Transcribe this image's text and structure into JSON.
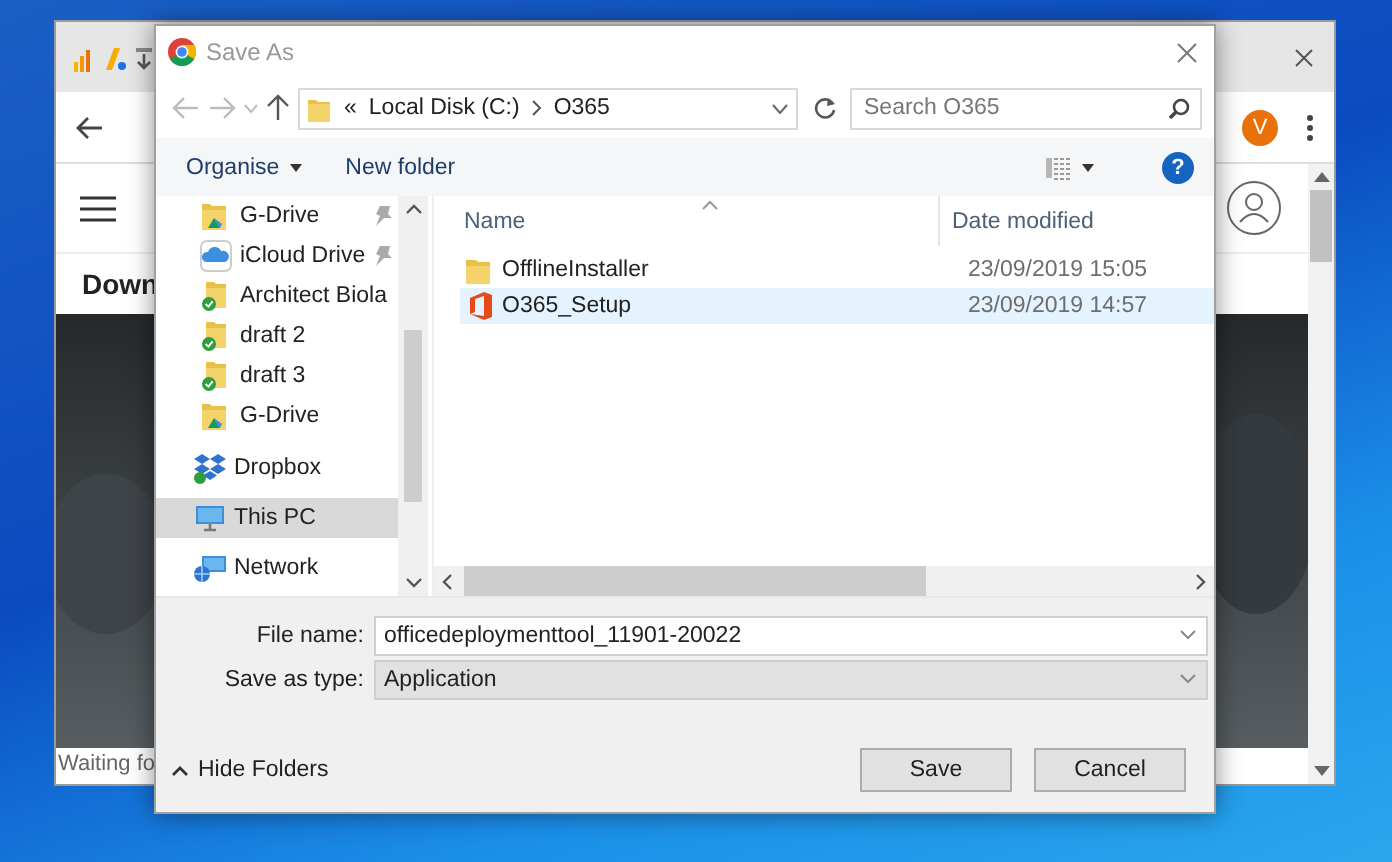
{
  "browser": {
    "page_heading": "Down",
    "status_text": "Waiting fo",
    "account_initial": "V"
  },
  "dialog": {
    "title": "Save As",
    "address": {
      "overflow_mark": "«",
      "path": [
        "Local Disk (C:)",
        "O365"
      ]
    },
    "search": {
      "placeholder": "Search O365"
    },
    "toolbar": {
      "organise": "Organise",
      "new_folder": "New folder",
      "help": "?"
    },
    "quick_access": [
      {
        "label": "G-Drive",
        "kind": "gdrive",
        "pinned": true,
        "selected": false
      },
      {
        "label": "iCloud Drive",
        "kind": "icloud",
        "pinned": true,
        "selected": false
      },
      {
        "label": "Architect Biola",
        "kind": "synced_folder",
        "pinned": false,
        "selected": false
      },
      {
        "label": "draft 2",
        "kind": "synced_folder",
        "pinned": false,
        "selected": false
      },
      {
        "label": "draft 3",
        "kind": "synced_folder",
        "pinned": false,
        "selected": false
      },
      {
        "label": "G-Drive",
        "kind": "gdrive",
        "pinned": false,
        "selected": false
      }
    ],
    "locations": [
      {
        "label": "Dropbox",
        "kind": "dropbox",
        "selected": false
      },
      {
        "label": "This PC",
        "kind": "pc",
        "selected": true
      },
      {
        "label": "Network",
        "kind": "network",
        "selected": false
      }
    ],
    "columns": [
      "Name",
      "Date modified"
    ],
    "files": [
      {
        "name": "OfflineInstaller",
        "date": "23/09/2019 15:05",
        "kind": "folder",
        "selected": false
      },
      {
        "name": "O365_Setup",
        "date": "23/09/2019 14:57",
        "kind": "office",
        "selected": true
      }
    ],
    "file_name": {
      "label": "File name:",
      "value": "officedeploymenttool_11901-20022"
    },
    "save_as_type": {
      "label": "Save as type:",
      "value": "Application"
    },
    "hide_folders": "Hide Folders",
    "buttons": [
      "Save",
      "Cancel"
    ]
  }
}
